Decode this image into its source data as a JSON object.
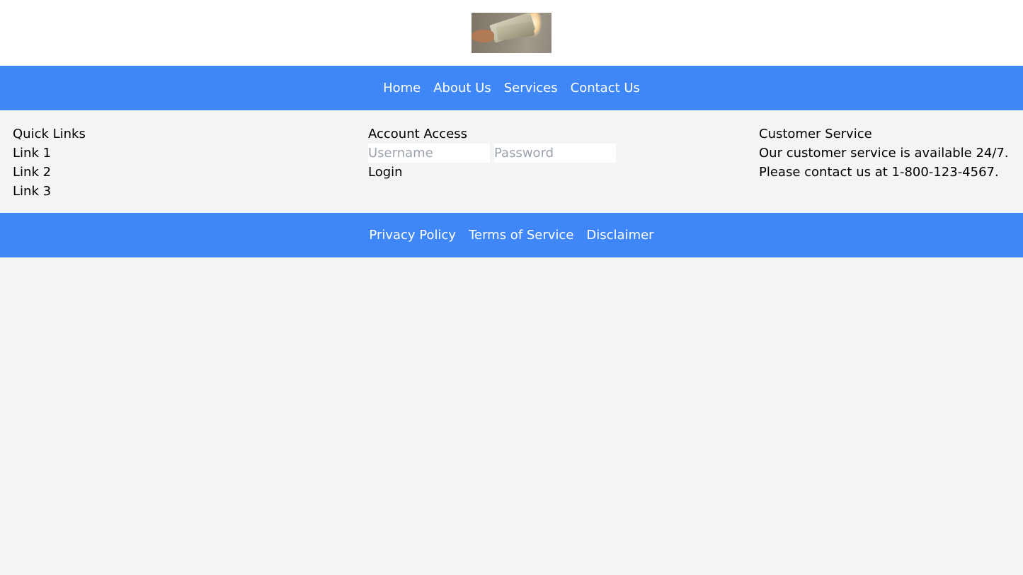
{
  "header": {
    "logo_name": "money-hand-logo"
  },
  "nav": {
    "items": [
      {
        "label": "Home"
      },
      {
        "label": "About Us"
      },
      {
        "label": "Services"
      },
      {
        "label": "Contact Us"
      }
    ]
  },
  "quick_links": {
    "title": "Quick Links",
    "items": [
      {
        "label": "Link 1"
      },
      {
        "label": "Link 2"
      },
      {
        "label": "Link 3"
      }
    ]
  },
  "account": {
    "title": "Account Access",
    "username_placeholder": "Username",
    "password_placeholder": "Password",
    "login_label": "Login"
  },
  "customer_service": {
    "title": "Customer Service",
    "line1": "Our customer service is available 24/7.",
    "line2": "Please contact us at 1-800-123-4567."
  },
  "footer": {
    "items": [
      {
        "label": "Privacy Policy"
      },
      {
        "label": "Terms of Service"
      },
      {
        "label": "Disclaimer"
      }
    ]
  },
  "colors": {
    "accent": "#3f87f7",
    "background": "#f3f4f6",
    "header_bg": "#ffffff"
  }
}
